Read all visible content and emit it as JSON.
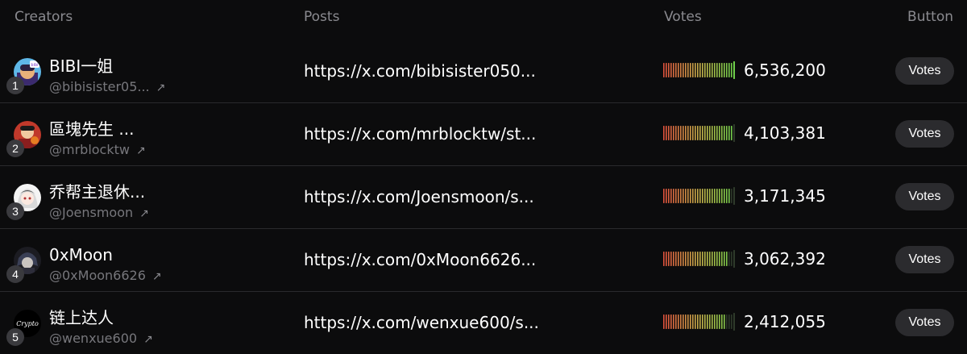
{
  "headers": {
    "creators": "Creators",
    "posts": "Posts",
    "votes": "Votes",
    "button": "Button"
  },
  "rows": [
    {
      "rank": "1",
      "name": "BIBI一姐",
      "handle": "@bibisister05...",
      "post": "https://x.com/bibisister050...",
      "votes": "6,536,200",
      "vote_bar_fill": 1.0,
      "button_label": "Votes",
      "avatar_icon": "bibi-avatar-icon"
    },
    {
      "rank": "2",
      "name": "區塊先生 ...",
      "handle": "@mrblocktw",
      "post": "https://x.com/mrblocktw/st...",
      "votes": "4,103,381",
      "vote_bar_fill": 0.95,
      "button_label": "Votes",
      "avatar_icon": "mrblock-avatar-icon"
    },
    {
      "rank": "3",
      "name": "乔帮主退休...",
      "handle": "@Joensmoon",
      "post": "https://x.com/Joensmoon/s...",
      "votes": "3,171,345",
      "vote_bar_fill": 0.92,
      "button_label": "Votes",
      "avatar_icon": "anime-avatar-icon"
    },
    {
      "rank": "4",
      "name": "0xMoon",
      "handle": "@0xMoon6626",
      "post": "https://x.com/0xMoon6626...",
      "votes": "3,062,392",
      "vote_bar_fill": 0.9,
      "button_label": "Votes",
      "avatar_icon": "dark-anime-avatar-icon"
    },
    {
      "rank": "5",
      "name": "链上达人",
      "handle": "@wenxue600",
      "post": "https://x.com/wenxue600/s...",
      "votes": "2,412,055",
      "vote_bar_fill": 0.85,
      "button_label": "Votes",
      "avatar_icon": "crypto-avatar-icon",
      "avatar_text": "Crypto"
    }
  ],
  "colors": {
    "background": "#0c0c0d",
    "divider": "#2a2a2d",
    "muted_text": "#8a8a8f",
    "button_bg": "#2b2b2e",
    "bar_low": "#e0533d",
    "bar_mid": "#c8b04a",
    "bar_high": "#6fd04a"
  }
}
